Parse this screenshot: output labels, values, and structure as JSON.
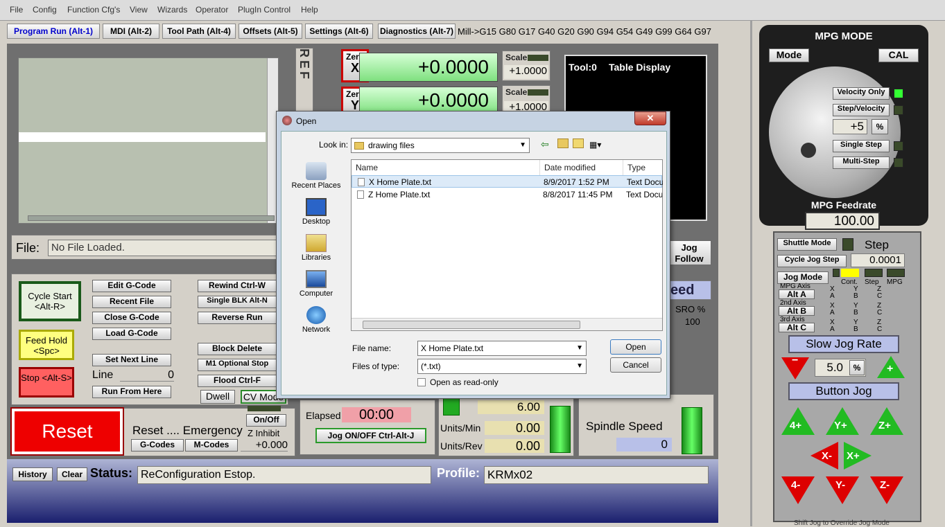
{
  "menu": [
    "File",
    "Config",
    "Function Cfg's",
    "View",
    "Wizards",
    "Operator",
    "PlugIn Control",
    "Help"
  ],
  "tabs": [
    "Program Run (Alt-1)",
    "MDI (Alt-2)",
    "Tool Path (Alt-4)",
    "Offsets (Alt-5)",
    "Settings (Alt-6)",
    "Diagnostics (Alt-7)"
  ],
  "gcodes": "Mill->G15  G80 G17 G40 G20 G90 G94 G54 G49 G99 G64 G97",
  "ref_label": "REF",
  "axes": [
    {
      "zero_label": "Zero",
      "axis": "X",
      "value": "+0.0000",
      "scale_label": "Scale",
      "scale": "+1.0000"
    },
    {
      "zero_label": "Zero",
      "axis": "Y",
      "value": "+0.0000",
      "scale_label": "Scale",
      "scale": "+1.0000"
    }
  ],
  "tool_display": {
    "tool": "Tool:0",
    "label": "Table Display"
  },
  "file": {
    "label": "File:",
    "value": "No File Loaded."
  },
  "jog_follow": "Jog Follow",
  "buttons": {
    "cycle_start": "Cycle Start <Alt-R>",
    "feed_hold": "Feed Hold <Spc>",
    "stop": "Stop <Alt-S>",
    "edit_gcode": "Edit G-Code",
    "recent_file": "Recent File",
    "close_gcode": "Close G-Code",
    "load_gcode": "Load G-Code",
    "set_next_line": "Set Next Line",
    "run_from_here": "Run From Here",
    "rewind": "Rewind Ctrl-W",
    "single_blk": "Single BLK Alt-N",
    "reverse_run": "Reverse Run",
    "block_delete": "Block Delete",
    "m1_optional": "M1 Optional Stop",
    "flood": "Flood Ctrl-F",
    "dwell": "Dwell",
    "cv_mode": "CV Mode",
    "reset": "Reset",
    "on_off": "On/Off",
    "gcodes_btn": "G-Codes",
    "mcodes_btn": "M-Codes",
    "jog_onoff": "Jog ON/OFF Ctrl-Alt-J",
    "history": "History",
    "clear": "Clear"
  },
  "line": {
    "label": "Line",
    "value": "0"
  },
  "reset_text": "Reset .... Emergency",
  "z_inhibit": {
    "label": "Z Inhibit",
    "value": "+0.000"
  },
  "elapsed": {
    "label": "Elapsed",
    "value": "00:00"
  },
  "feed": {
    "value": "6.00",
    "units_min_label": "Units/Min",
    "units_min": "0.00",
    "units_rev_label": "Units/Rev",
    "units_rev": "0.00"
  },
  "spindle": {
    "label": "Spindle Speed",
    "value": "0",
    "sro_label": "SRO %",
    "sro": "100",
    "speed_label": "eed"
  },
  "status": {
    "label": "Status:",
    "value": "ReConfiguration Estop.",
    "profile_label": "Profile:",
    "profile": "KRMx02"
  },
  "mpg": {
    "title": "MPG MODE",
    "mode": "Mode",
    "cal": "CAL",
    "velocity_only": "Velocity Only",
    "step_velocity": "Step/Velocity",
    "percent_value": "+5",
    "percent": "%",
    "single_step": "Single Step",
    "multi_step": "Multi-Step",
    "feedrate_label": "MPG Feedrate",
    "feedrate": "100.00",
    "shuttle_mode": "Shuttle Mode",
    "step": "Step",
    "cycle_jog_step": "Cycle Jog Step",
    "jog_step_value": "0.0001",
    "jog_mode": "Jog Mode",
    "cont": "Cont.",
    "step_small": "Step",
    "mpg_small": "MPG",
    "axis1_label": "MPG Axis",
    "axis1": "Alt A",
    "axis2_label": "2nd Axis",
    "axis2": "Alt B",
    "axis3_label": "3rd Axis",
    "axis3": "Alt C",
    "axis_letters": [
      "X",
      "A",
      "Y",
      "B",
      "Z",
      "C"
    ],
    "slow_jog_rate": "Slow Jog Rate",
    "jog_rate": "5.0",
    "jog_percent": "%",
    "button_jog": "Button Jog",
    "jog_buttons": [
      "4+",
      "Y+",
      "Z+",
      "X-",
      "X+",
      "4-",
      "Y-",
      "Z-"
    ],
    "bottom_text": "Shift Jog to Override Jog Mode"
  },
  "dialog": {
    "title": "Open",
    "look_in_label": "Look in:",
    "look_in": "drawing files",
    "places": [
      "Recent Places",
      "Desktop",
      "Libraries",
      "Computer",
      "Network"
    ],
    "columns": [
      "Name",
      "Date modified",
      "Type"
    ],
    "files": [
      {
        "name": "X Home Plate.txt",
        "date": "8/9/2017 1:52 PM",
        "type": "Text Docu"
      },
      {
        "name": "Z Home Plate.txt",
        "date": "8/8/2017 11:45 PM",
        "type": "Text Docu"
      }
    ],
    "file_name_label": "File name:",
    "file_name": "X Home Plate.txt",
    "file_type_label": "Files of type:",
    "file_type": "(*.txt)",
    "read_only": "Open as read-only",
    "open": "Open",
    "cancel": "Cancel"
  }
}
